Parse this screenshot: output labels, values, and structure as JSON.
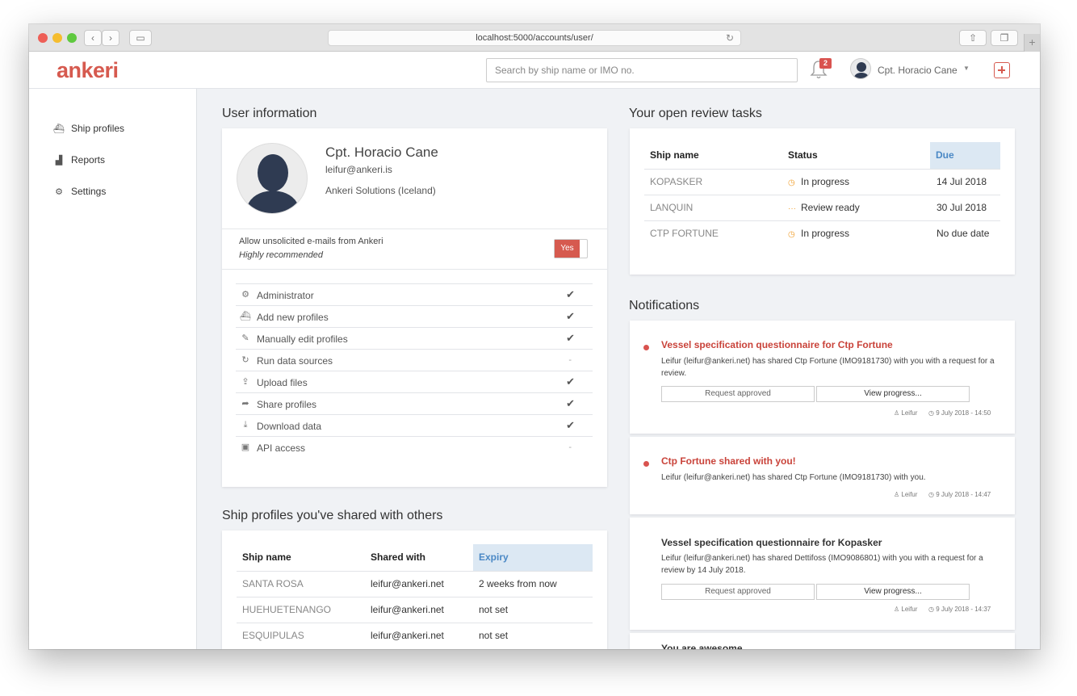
{
  "browser": {
    "url": "localhost:5000/accounts/user/"
  },
  "header": {
    "logo": "ankeri",
    "search_placeholder": "Search by ship name or IMO no.",
    "notification_count": "2",
    "user_name": "Cpt. Horacio Cane"
  },
  "sidebar": {
    "items": [
      {
        "label": "Ship profiles",
        "icon": "ship-icon"
      },
      {
        "label": "Reports",
        "icon": "chart-icon"
      },
      {
        "label": "Settings",
        "icon": "gear-icon"
      }
    ]
  },
  "user_info": {
    "section_title": "User information",
    "name": "Cpt. Horacio Cane",
    "email": "leifur@ankeri.is",
    "organization": "Ankeri Solutions (Iceland)",
    "allow_emails_label": "Allow unsolicited e-mails from Ankeri",
    "allow_emails_note": "Highly recommended",
    "allow_emails_toggle": "Yes",
    "permissions": [
      {
        "label": "Administrator",
        "value": "✔",
        "icon": "gear-icon"
      },
      {
        "label": "Add new profiles",
        "value": "✔",
        "icon": "ship-icon"
      },
      {
        "label": "Manually edit profiles",
        "value": "✔",
        "icon": "edit-icon"
      },
      {
        "label": "Run data sources",
        "value": "-",
        "icon": "refresh-icon"
      },
      {
        "label": "Upload files",
        "value": "✔",
        "icon": "upload-icon"
      },
      {
        "label": "Share profiles",
        "value": "✔",
        "icon": "share-icon"
      },
      {
        "label": "Download data",
        "value": "✔",
        "icon": "download-icon"
      },
      {
        "label": "API access",
        "value": "-",
        "icon": "terminal-icon"
      }
    ]
  },
  "shared_profiles": {
    "section_title": "Ship profiles you've shared with others",
    "headers": [
      "Ship name",
      "Shared with",
      "Expiry"
    ],
    "rows": [
      [
        "SANTA ROSA",
        "leifur@ankeri.net",
        "2 weeks from now"
      ],
      [
        "HUEHUETENANGO",
        "leifur@ankeri.net",
        "not set"
      ],
      [
        "ESQUIPULAS",
        "leifur@ankeri.net",
        "not set"
      ]
    ]
  },
  "review_tasks": {
    "section_title": "Your open review tasks",
    "headers": [
      "Ship name",
      "Status",
      "Due"
    ],
    "rows": [
      {
        "ship": "KOPASKER",
        "status": "In progress",
        "status_icon": "clock-icon",
        "due": "14 Jul 2018"
      },
      {
        "ship": "LANQUIN",
        "status": "Review ready",
        "status_icon": "dots-icon",
        "due": "30 Jul 2018"
      },
      {
        "ship": "CTP FORTUNE",
        "status": "In progress",
        "status_icon": "clock-icon",
        "due": "No due date"
      }
    ]
  },
  "notifications": {
    "section_title": "Notifications",
    "items": [
      {
        "title": "Vessel specification questionnaire for Ctp Fortune",
        "body": "Leifur (leifur@ankeri.net) has shared Ctp Fortune (IMO9181730) with you with a request for a review.",
        "button1": "Request approved",
        "button2": "View progress...",
        "author": "Leifur",
        "time": "9 July 2018 - 14:50",
        "unread": true
      },
      {
        "title": "Ctp Fortune shared with you!",
        "body": "Leifur (leifur@ankeri.net) has shared Ctp Fortune (IMO9181730) with you.",
        "author": "Leifur",
        "time": "9 July 2018 - 14:47",
        "unread": true
      },
      {
        "title": "Vessel specification questionnaire for Kopasker",
        "body": "Leifur (leifur@ankeri.net) has shared Dettifoss (IMO9086801) with you with a request for a review by 14 July 2018.",
        "button1": "Request approved",
        "button2": "View progress...",
        "author": "Leifur",
        "time": "9 July 2018 - 14:37",
        "unread": false
      },
      {
        "title": "You are awesome"
      }
    ]
  },
  "colors": {
    "brand": "#d65a4f",
    "sorted_header": "#dce8f3",
    "status_icon": "#f0a030"
  }
}
